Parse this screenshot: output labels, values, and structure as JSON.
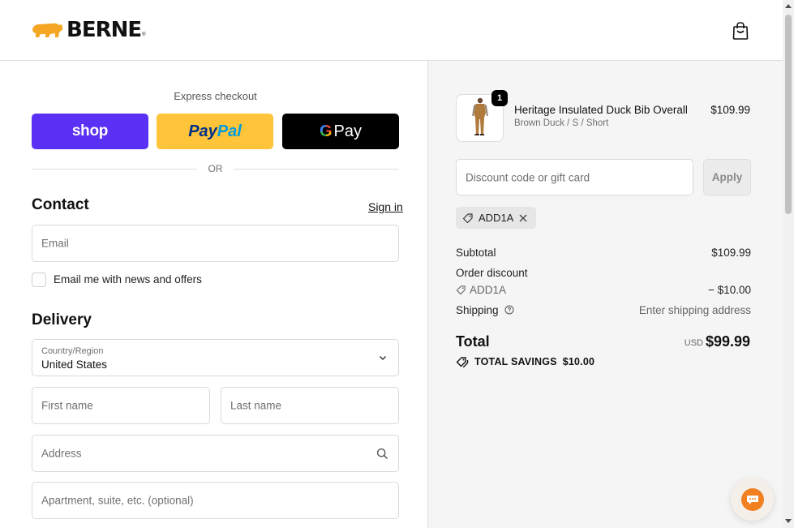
{
  "brand": {
    "name": "BERNE",
    "reg_mark": "®",
    "accent": "#f5a623"
  },
  "header": {
    "cart_icon": "shopping-bag-icon"
  },
  "express": {
    "label": "Express checkout",
    "shop_label": "shop",
    "paypal_pay": "Pay",
    "paypal_pal": "Pal",
    "gpay_g": "G",
    "gpay_label": "Pay",
    "shop_color": "#5a31f4",
    "paypal_color": "#ffc439",
    "gpay_color": "#000000"
  },
  "divider": {
    "text": "OR"
  },
  "contact": {
    "title": "Contact",
    "sign_in": "Sign in",
    "email_placeholder": "Email",
    "newsletter_label": "Email me with news and offers"
  },
  "delivery": {
    "title": "Delivery",
    "country_label": "Country/Region",
    "country_value": "United States",
    "first_name_placeholder": "First name",
    "last_name_placeholder": "Last name",
    "address_placeholder": "Address",
    "apartment_placeholder": "Apartment, suite, etc. (optional)"
  },
  "summary": {
    "item": {
      "quantity": "1",
      "name": "Heritage Insulated Duck Bib Overall",
      "variant": "Brown Duck / S / Short",
      "price": "$109.99"
    },
    "discount_placeholder": "Discount code or gift card",
    "apply_label": "Apply",
    "applied_code": "ADD1A",
    "subtotal_label": "Subtotal",
    "subtotal_value": "$109.99",
    "order_discount_label": "Order discount",
    "discount_code": "ADD1A",
    "discount_value": "− $10.00",
    "shipping_label": "Shipping",
    "shipping_value": "Enter shipping address",
    "total_label": "Total",
    "total_currency": "USD",
    "total_value": "$99.99",
    "savings_label": "TOTAL SAVINGS",
    "savings_value": "$10.00"
  },
  "chat": {
    "icon": "chat-bubble-icon",
    "color": "#f08020"
  }
}
